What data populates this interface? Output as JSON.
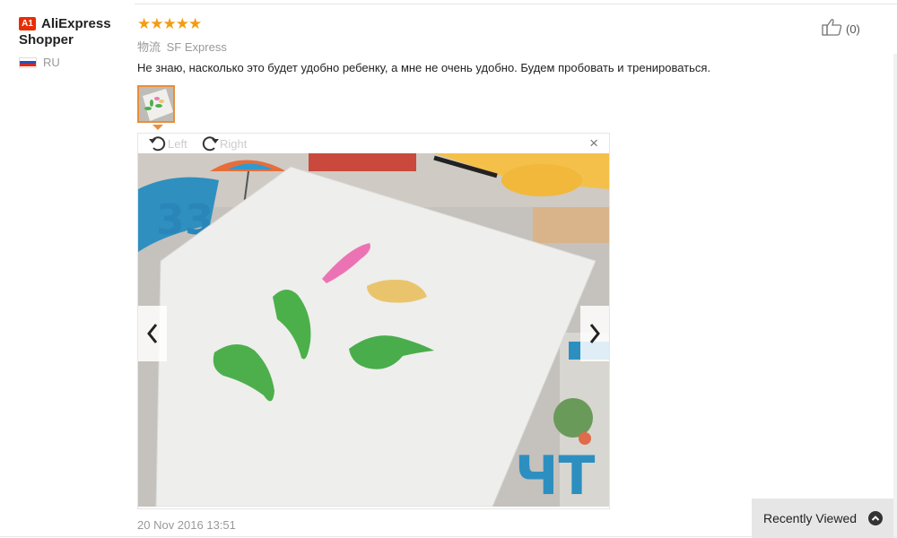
{
  "reviewer": {
    "badge": "A1",
    "name_line1": "AliExpress",
    "name_line2": "Shopper",
    "country": "RU",
    "flag_colors": [
      "#ffffff",
      "#2b4fb3",
      "#d52b1e"
    ]
  },
  "review": {
    "rating": 5,
    "stars": [
      "★",
      "★",
      "★",
      "★",
      "★"
    ],
    "star_color": "#f39c12",
    "shipping_label": "物流",
    "shipping_method": "SF Express",
    "text": "Не знаю, насколько это будет удобно ребенку, а мне не очень удобно. Будем пробовать и тренироваться.",
    "date": "20 Nov 2016 13:51"
  },
  "helpful": {
    "icon": "thumbs-up-icon",
    "count": "(0)"
  },
  "viewer": {
    "rotate_left_label": "Left",
    "rotate_right_label": "Right",
    "close_label": "×",
    "prev_icon": "chevron-left-icon",
    "next_icon": "chevron-right-icon"
  },
  "recent_viewed": {
    "label": "Recently Viewed",
    "icon": "chevron-up-circle-icon"
  },
  "accent_color": "#e88f3a"
}
